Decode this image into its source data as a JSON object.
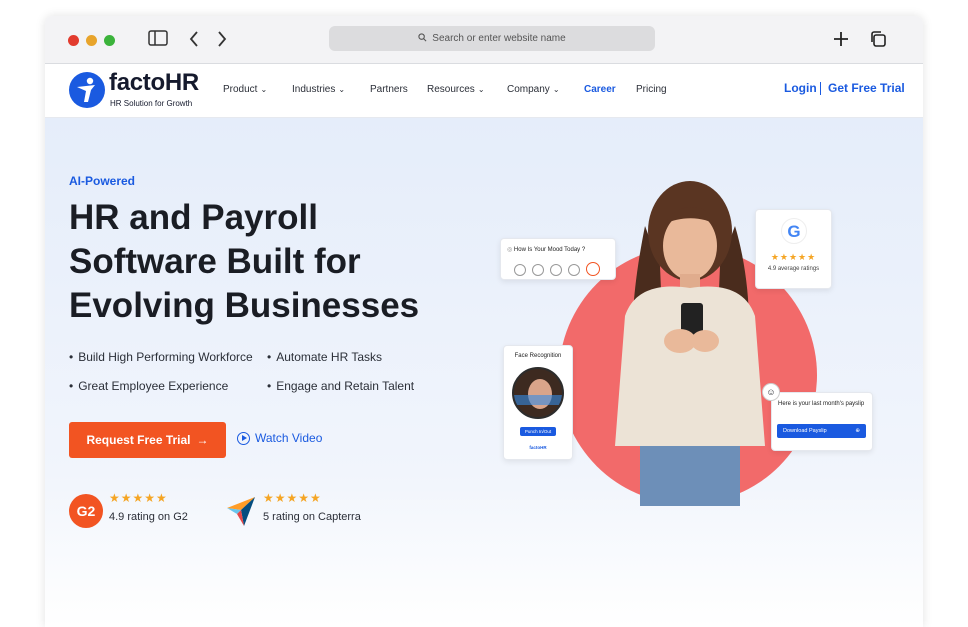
{
  "browser": {
    "url_placeholder": "Search or enter website name",
    "back_icon": "chevron-left-icon",
    "forward_icon": "chevron-right-icon",
    "new_tab_icon": "plus-icon",
    "tabs_icon": "tabs-icon"
  },
  "brand": {
    "name": "factoHR",
    "tagline": "HR Solution for Growth",
    "color": "#1a5ae0"
  },
  "nav": {
    "items": [
      {
        "label": "Product",
        "has_dropdown": true
      },
      {
        "label": "Industries",
        "has_dropdown": true
      },
      {
        "label": "Partners",
        "has_dropdown": false
      },
      {
        "label": "Resources",
        "has_dropdown": true
      },
      {
        "label": "Company",
        "has_dropdown": true
      },
      {
        "label": "Career",
        "has_dropdown": false,
        "active": true
      },
      {
        "label": "Pricing",
        "has_dropdown": false
      }
    ],
    "login": "Login",
    "free_trial": "Get Free Trial"
  },
  "hero": {
    "eyebrow": "AI-Powered",
    "headline_lines": [
      "HR and Payroll",
      "Software Built for",
      "Evolving Businesses"
    ],
    "bullets": [
      "Build High Performing Workforce",
      "Automate HR Tasks",
      "Great Employee Experience",
      "Engage and Retain Talent"
    ],
    "cta_label": "Request Free Trial",
    "cta_color": "#f25422",
    "watch_label": "Watch Video"
  },
  "ratings": [
    {
      "badge": "G2",
      "stars": "★★★★★",
      "text": "4.9 rating on G2"
    },
    {
      "badge": "capterra-logo-icon",
      "stars": "★★★★★",
      "text": "5 rating on Capterra"
    }
  ],
  "cards": {
    "mood": {
      "title": "How Is Your Mood Today ?"
    },
    "google": {
      "stars": "★★★★★",
      "text": "4.9 average ratings"
    },
    "face": {
      "title": "Face Recognition",
      "button": "Punch In/Out",
      "footer": "factoHR"
    },
    "payslip": {
      "text": "Here is your last month's payslip",
      "button": "Download Payslip"
    }
  }
}
